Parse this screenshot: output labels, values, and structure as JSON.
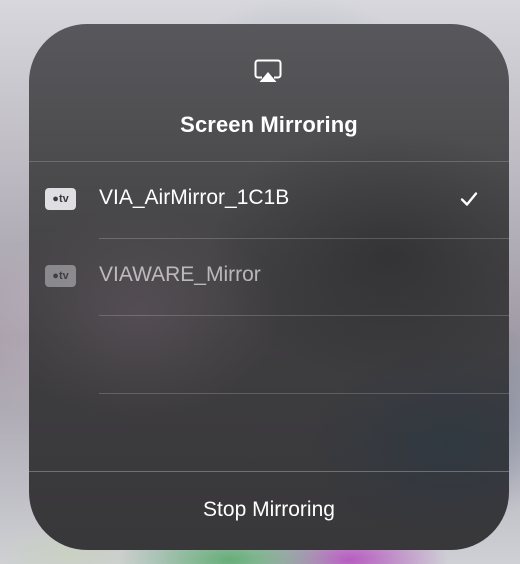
{
  "panel": {
    "title": "Screen Mirroring",
    "title_icon": "airplay-icon"
  },
  "devices": [
    {
      "badge": "tv",
      "badge_icon": "apple-tv-icon",
      "name": "VIA_AirMirror_1C1B",
      "selected": true,
      "selected_icon": "checkmark-icon"
    },
    {
      "badge": "tv",
      "badge_icon": "apple-tv-icon",
      "name": "VIAWARE_Mirror",
      "selected": false
    }
  ],
  "footer": {
    "stop_label": "Stop Mirroring"
  },
  "colors": {
    "panel_background": "#4a494c",
    "text_primary": "#ffffff",
    "text_dim": "#a3a3a6",
    "separator": "#6a6a6d"
  }
}
